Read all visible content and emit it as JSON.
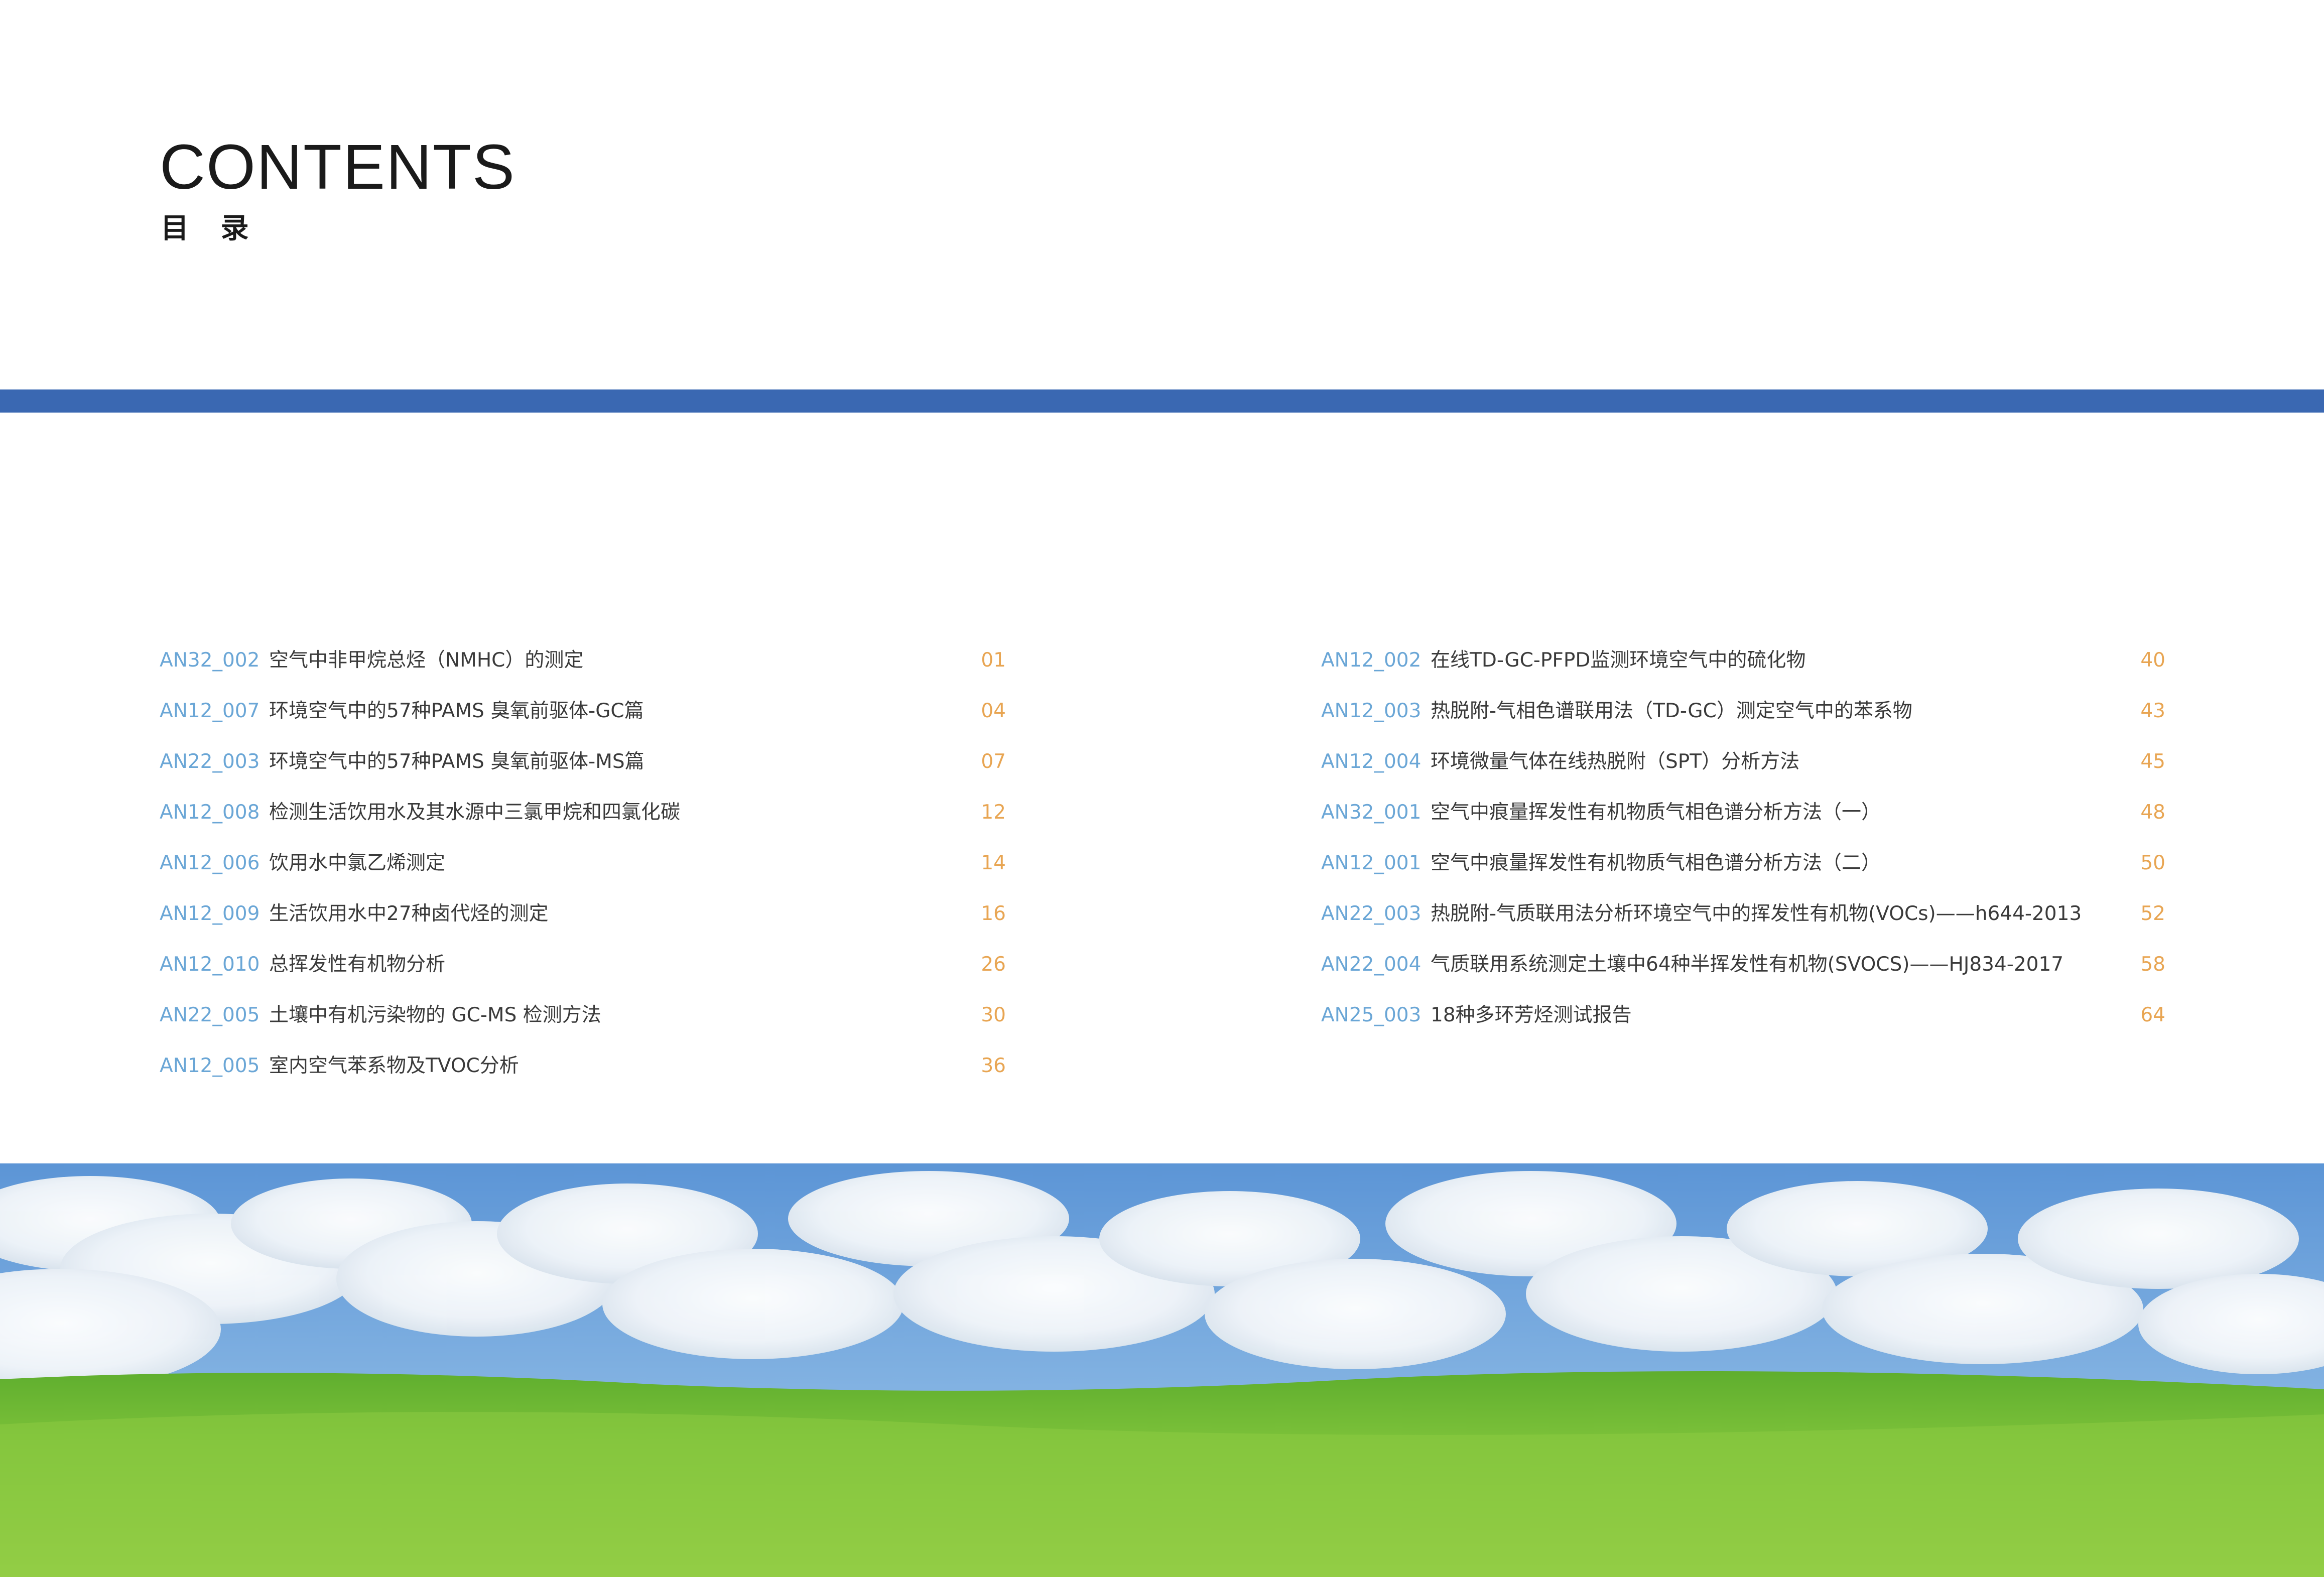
{
  "header": {
    "title": "CONTENTS",
    "subtitle": "目 录",
    "accent_color": "#3a68b2"
  },
  "toc": {
    "left": [
      {
        "code": "AN32_002",
        "title": "空气中非甲烷总烃（NMHC）的测定",
        "page": "01"
      },
      {
        "code": "AN12_007",
        "title": "环境空气中的57种PAMS 臭氧前驱体-GC篇",
        "page": "04"
      },
      {
        "code": "AN22_003",
        "title": "环境空气中的57种PAMS 臭氧前驱体-MS篇",
        "page": "07"
      },
      {
        "code": "AN12_008",
        "title": "检测生活饮用水及其水源中三氯甲烷和四氯化碳",
        "page": "12"
      },
      {
        "code": "AN12_006",
        "title": "饮用水中氯乙烯测定",
        "page": "14"
      },
      {
        "code": "AN12_009",
        "title": "生活饮用水中27种卤代烃的测定",
        "page": "16"
      },
      {
        "code": "AN12_010",
        "title": "总挥发性有机物分析",
        "page": "26"
      },
      {
        "code": "AN22_005",
        "title": "土壤中有机污染物的 GC-MS 检测方法",
        "page": "30"
      },
      {
        "code": "AN12_005",
        "title": "室内空气苯系物及TVOC分析",
        "page": "36"
      }
    ],
    "right": [
      {
        "code": "AN12_002",
        "title": "在线TD-GC-PFPD监测环境空气中的硫化物",
        "page": "40"
      },
      {
        "code": "AN12_003",
        "title": "热脱附-气相色谱联用法（TD-GC）测定空气中的苯系物",
        "page": "43"
      },
      {
        "code": "AN12_004",
        "title": "环境微量气体在线热脱附（SPT）分析方法",
        "page": "45"
      },
      {
        "code": "AN32_001",
        "title": "空气中痕量挥发性有机物质气相色谱分析方法（一）",
        "page": "48"
      },
      {
        "code": "AN12_001",
        "title": "空气中痕量挥发性有机物质气相色谱分析方法（二）",
        "page": "50"
      },
      {
        "code": "AN22_003",
        "title": "热脱附-气质联用法分析环境空气中的挥发性有机物(VOCs)——h644-2013",
        "page": "52"
      },
      {
        "code": "AN22_004",
        "title": "气质联用系统测定土壤中64种半挥发性有机物(SVOCS)——HJ834-2017",
        "page": "58"
      },
      {
        "code": "AN25_003",
        "title": "18种多环芳烃测试报告",
        "page": "64"
      }
    ]
  },
  "colors": {
    "code": "#6aa6d6",
    "title": "#3a3a3a",
    "page": "#e8a552",
    "sky_top": "#5c95d6",
    "grass": "#7dc23a"
  }
}
